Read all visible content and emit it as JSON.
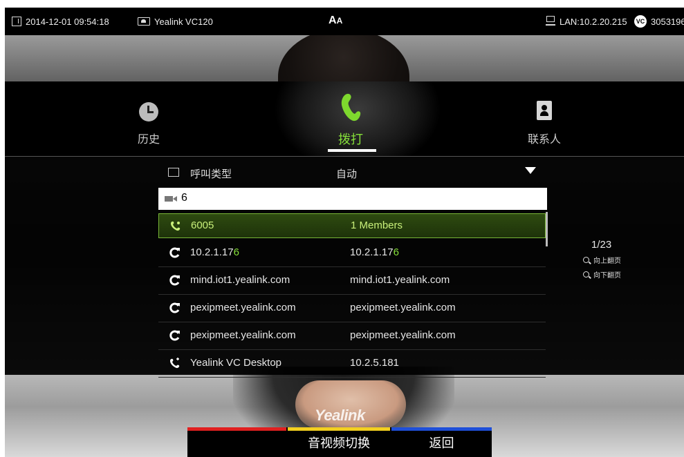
{
  "status_bar": {
    "datetime": "2014-12-01 09:54:18",
    "device": "Yealink VC120",
    "font_toggle": "A",
    "network": "LAN:10.2.20.215",
    "account_badge": "VC",
    "account": "3053196"
  },
  "tabs": [
    {
      "label": "历史",
      "icon": "clock-icon"
    },
    {
      "label": "拨打",
      "icon": "phone-icon",
      "active": true
    },
    {
      "label": "联系人",
      "icon": "contacts-book-icon"
    }
  ],
  "call_type": {
    "label": "呼叫类型",
    "value": "自动"
  },
  "dial_input": {
    "value": "6"
  },
  "results": [
    {
      "name": "6005",
      "number": "1 Members",
      "icon": "conference-icon",
      "selected": true
    },
    {
      "name_pre": "10.2.1.17",
      "name_hl": "6",
      "num_pre": "10.2.1.17",
      "num_hl": "6",
      "icon": "outgoing-call-icon"
    },
    {
      "name": "mind.iot1.yealink.com",
      "number": "mind.iot1.yealink.com",
      "icon": "outgoing-call-icon"
    },
    {
      "name": "pexipmeet.yealink.com",
      "number": "pexipmeet.yealink.com",
      "icon": "outgoing-call-icon"
    },
    {
      "name": "pexipmeet.yealink.com",
      "number": "pexipmeet.yealink.com",
      "icon": "outgoing-call-icon"
    },
    {
      "name": "Yealink VC Desktop",
      "number": "10.2.5.181",
      "icon": "contact-call-icon"
    }
  ],
  "pager": {
    "count": "1/23",
    "page_up": "向上翻页",
    "page_down": "向下翻页"
  },
  "brand": "Yealink",
  "softkeys": [
    {
      "label": "",
      "color": "#e02020"
    },
    {
      "label": "音视频切换",
      "color": "#f2cf1f"
    },
    {
      "label": "返回",
      "color": "#1f4fd8"
    }
  ]
}
